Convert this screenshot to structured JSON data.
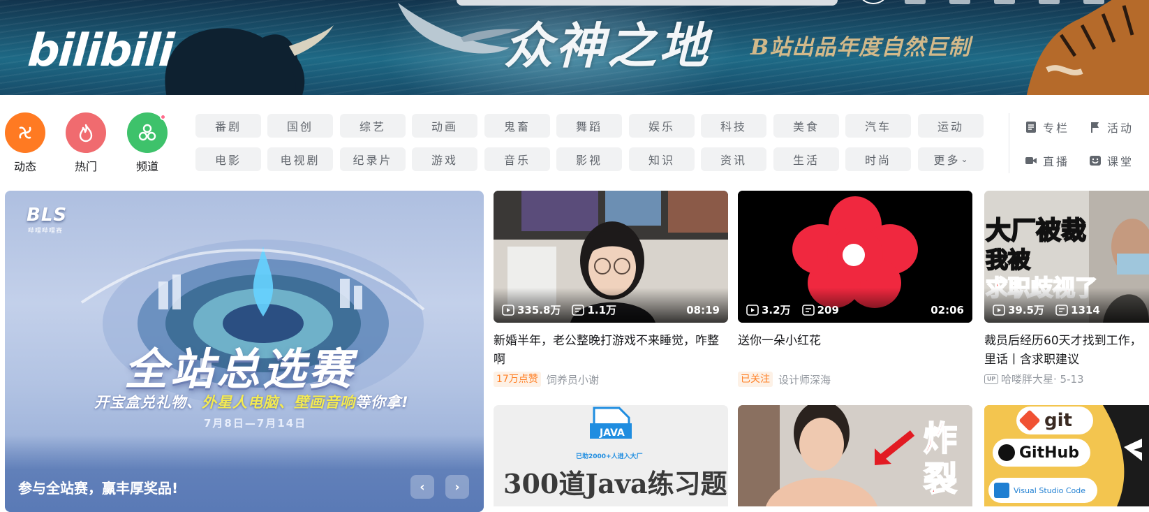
{
  "banner": {
    "logo": "bilibili",
    "title": "众神之地",
    "slogan": "B站出品年度自然巨制"
  },
  "round_nav": [
    {
      "label": "动态",
      "color": "#ff7a22",
      "icon": "windmill-icon"
    },
    {
      "label": "热门",
      "color": "#f06b6f",
      "icon": "flame-icon"
    },
    {
      "label": "频道",
      "color": "#3ec26b",
      "icon": "channel-icon"
    }
  ],
  "channels_row1": [
    "番剧",
    "国创",
    "综艺",
    "动画",
    "鬼畜",
    "舞蹈",
    "娱乐",
    "科技",
    "美食",
    "汽车",
    "运动"
  ],
  "channels_row2": [
    "电影",
    "电视剧",
    "纪录片",
    "游戏",
    "音乐",
    "影视",
    "知识",
    "资讯",
    "生活",
    "时尚",
    "更多"
  ],
  "more_chevron": "⌄",
  "side_links": [
    {
      "label": "专栏",
      "icon": "article-icon"
    },
    {
      "label": "活动",
      "icon": "flag-icon"
    },
    {
      "label": "直播",
      "icon": "live-icon"
    },
    {
      "label": "课堂",
      "icon": "classroom-icon"
    }
  ],
  "carousel": {
    "logo": "BLS",
    "logo_sub": "哔哩哔哩赛",
    "event_title": "全站总选赛",
    "event_sub_1": "开宝盒兑礼物、",
    "event_sub_2": "外星人电脑、",
    "event_sub_3": "壁画音响",
    "event_sub_4": "等你拿!",
    "event_date": "7月8日—7月14日",
    "caption": "参与全站赛，赢丰厚奖品!",
    "prev": "‹",
    "next": "›"
  },
  "videos": [
    {
      "views": "335.8万",
      "danmaku": "1.1万",
      "duration": "08:19",
      "title": "新婚半年，老公整晚打游戏不来睡觉，咋整啊",
      "badge": "17万点赞",
      "author": "饲养员小谢",
      "date": ""
    },
    {
      "views": "3.2万",
      "danmaku": "209",
      "duration": "02:06",
      "title": "送你一朵小红花",
      "badge": "已关注",
      "author": "设计师深海",
      "date": ""
    },
    {
      "views": "39.5万",
      "danmaku": "1314",
      "duration": "",
      "title": "裁员后经历60天才找到工作，里话丨含求职建议",
      "badge": "",
      "author": "哈喽胖大星",
      "date": " · 5-13",
      "thumb_line1": "大厂被裁",
      "thumb_line2": "我被",
      "thumb_line3": "求职歧视了"
    }
  ],
  "row2_thumbs": {
    "java_label": "JAVA",
    "java_sub": "已助2000+人进入大厂",
    "java_title": "300道Java练习题",
    "fitness_text_1": "炸",
    "fitness_text_2": "裂",
    "git_label": "git",
    "github_label": "GitHub",
    "vscode_label": "Visual Studio Code"
  }
}
